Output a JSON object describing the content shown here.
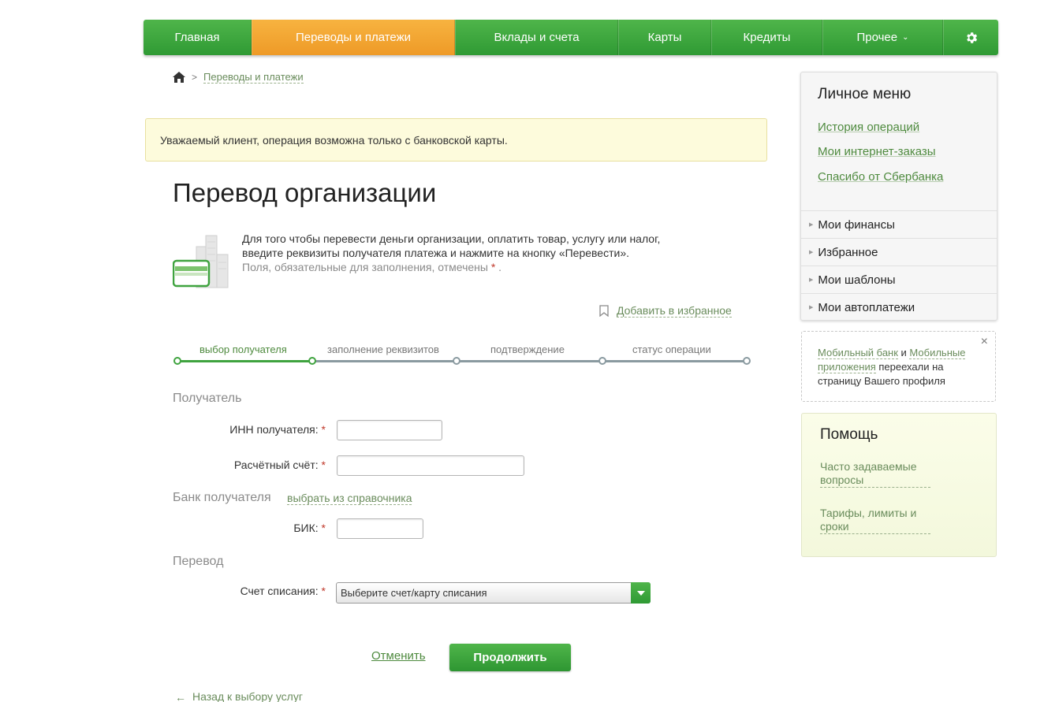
{
  "nav": {
    "items": [
      {
        "label": "Главная",
        "active": false
      },
      {
        "label": "Переводы и платежи",
        "active": true
      },
      {
        "label": "Вклады и счета",
        "active": false
      },
      {
        "label": "Карты",
        "active": false
      },
      {
        "label": "Кредиты",
        "active": false
      },
      {
        "label": "Прочее",
        "active": false
      }
    ],
    "more_caret": "⌄",
    "settings_icon": "gear-icon"
  },
  "breadcrumb": {
    "home_icon": "home-icon",
    "separator": ">",
    "current": "Переводы и платежи"
  },
  "notice": {
    "text": "Уважаемый клиент, операция возможна только с банковской карты."
  },
  "page": {
    "title": "Перевод организации",
    "intro_line1": "Для того чтобы перевести деньги организации, оплатить товар, услугу или налог,",
    "intro_line2": "введите реквизиты получателя платежа и нажмите на кнопку «Перевести».",
    "required_note": "Поля, обязательные для заполнения, отмечены",
    "required_mark": "*",
    "required_dot": ".",
    "add_favorite": "Добавить в избранное"
  },
  "steps": [
    {
      "label": "выбор получателя",
      "active": true
    },
    {
      "label": "заполнение реквизитов",
      "active": false
    },
    {
      "label": "подтверждение",
      "active": false
    },
    {
      "label": "статус операции",
      "active": false
    }
  ],
  "form": {
    "recipient_section": "Получатель",
    "inn_label": "ИНН получателя:",
    "inn_value": "",
    "account_label": "Расчётный счёт:",
    "account_value": "",
    "bank_section": "Банк получателя",
    "bank_choose_link": "выбрать из справочника",
    "bik_label": "БИК:",
    "bik_value": "",
    "transfer_section": "Перевод",
    "debit_label": "Счет списания:",
    "debit_selected": "Выберите счет/карту списания",
    "required_mark": "*"
  },
  "actions": {
    "cancel": "Отменить",
    "continue": "Продолжить",
    "back": "Назад к выбору услуг"
  },
  "sidebar": {
    "personal_title": "Личное меню",
    "links": [
      "История операций",
      "Мои интернет-заказы",
      "Спасибо от Сбербанка"
    ],
    "rows": [
      "Мои финансы",
      "Избранное",
      "Мои шаблоны",
      "Мои автоплатежи"
    ],
    "promo": {
      "link1": "Мобильный банк",
      "and": " и ",
      "link2": "Мобильные приложения",
      "rest": " переехали на страницу Вашего профиля",
      "close": "×"
    },
    "help": {
      "title": "Помощь",
      "faq": "Часто задаваемые вопросы",
      "tariffs": "Тарифы, лимиты и сроки"
    }
  },
  "colors": {
    "brand_green": "#3fa33f",
    "accent_orange": "#f0a030",
    "notice_bg": "#fdfbdc",
    "required_red": "#c0392b"
  }
}
